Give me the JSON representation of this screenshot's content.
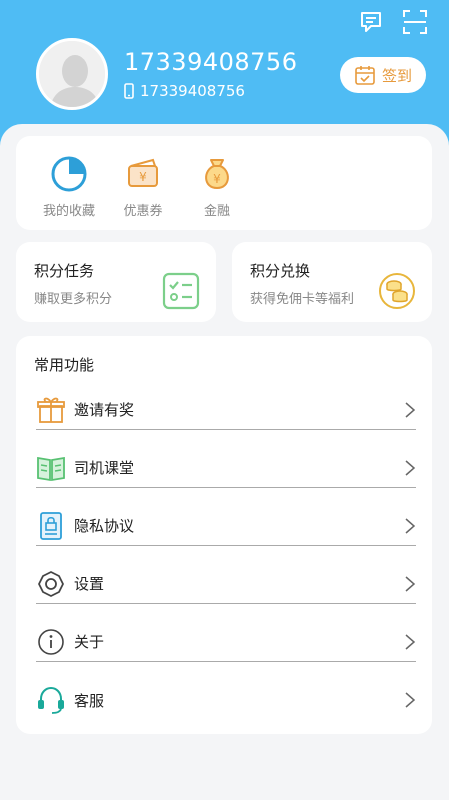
{
  "header": {
    "phone_big": "17339408756",
    "phone_small": "17339408756",
    "signin_label": "签到",
    "icons": [
      "message-icon",
      "scan-icon"
    ]
  },
  "quick_actions": [
    {
      "label": "我的收藏",
      "icon": "pie-chart-icon"
    },
    {
      "label": "优惠券",
      "icon": "coupon-icon"
    },
    {
      "label": "金融",
      "icon": "money-bag-icon"
    }
  ],
  "tasks": {
    "left": {
      "title": "积分任务",
      "subtitle": "赚取更多积分"
    },
    "right": {
      "title": "积分兑换",
      "subtitle": "获得免佣卡等福利"
    }
  },
  "functions": {
    "title": "常用功能",
    "items": [
      {
        "label": "邀请有奖",
        "icon": "gift-icon"
      },
      {
        "label": "司机课堂",
        "icon": "book-icon"
      },
      {
        "label": "隐私协议",
        "icon": "lock-document-icon"
      },
      {
        "label": "设置",
        "icon": "settings-icon"
      },
      {
        "label": "关于",
        "icon": "info-icon"
      },
      {
        "label": "客服",
        "icon": "headset-icon"
      }
    ]
  },
  "colors": {
    "header": "#4fbcf4",
    "accent_orange": "#e79a3c",
    "accent_green": "#7ccf8a",
    "accent_blue": "#2d9fd8"
  }
}
